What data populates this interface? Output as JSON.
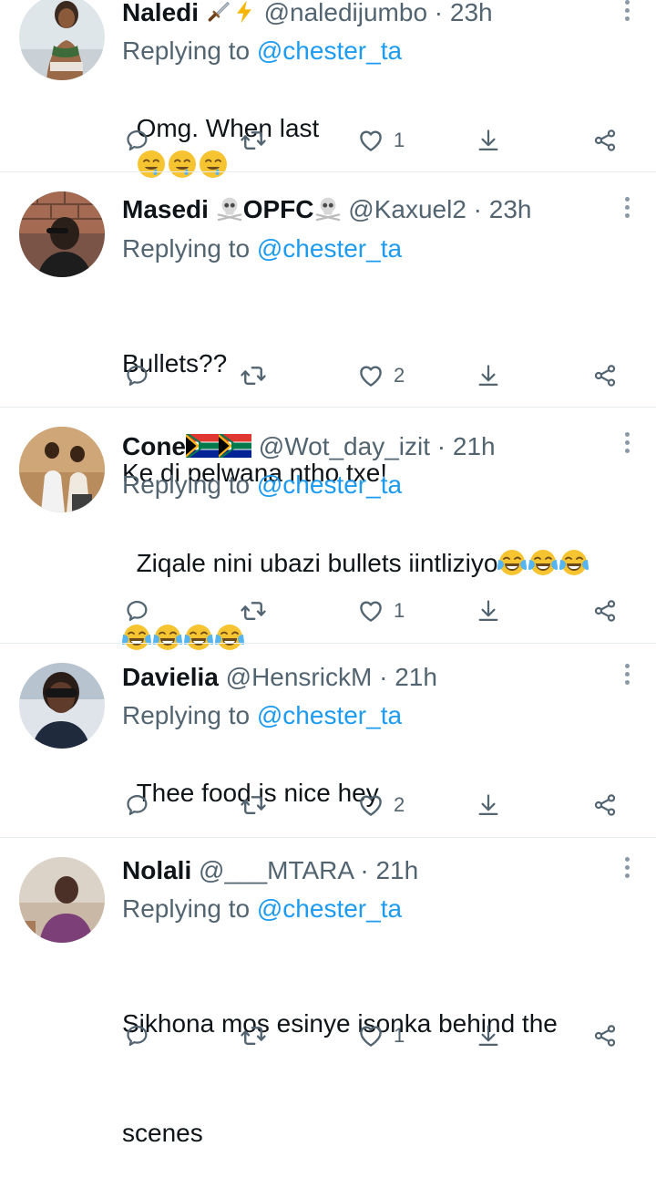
{
  "reply_prefix": "Replying to ",
  "reply_target": "@chester_ta",
  "tweets": [
    {
      "name": "Naledi",
      "handle": "@naledijumbo",
      "dot": "·",
      "time": "23h",
      "text_line1": "Omg. When last",
      "like_count": "1",
      "emoji": "drooling-face"
    },
    {
      "name": "Masedi",
      "name_mid": "OPFC",
      "handle": "@Kaxuel2",
      "dot": "·",
      "time": "23h",
      "text_line1": "Bullets??",
      "text_line2": "Ke di pelwana ntho txe!",
      "like_count": "2"
    },
    {
      "name": "Cone",
      "handle": "@Wot_day_izit",
      "dot": "·",
      "time": "21h",
      "text_line1": "Ziqale nini ubazi bullets iintliziyo",
      "like_count": "1",
      "emoji": "face-with-tears-of-joy"
    },
    {
      "name": "Davielia",
      "handle": "@HensrickM",
      "dot": "·",
      "time": "21h",
      "text_line1": "Thee food is nice hey",
      "like_count": "2"
    },
    {
      "name": "Nolali",
      "handle": "@___MTARA",
      "dot": "·",
      "time": "21h",
      "text_line1": "Sikhona mos esinye isonka behind the",
      "text_line2": "scenes",
      "like_count": "1"
    }
  ],
  "colors": {
    "accent": "#1d9bf0",
    "muted": "#536471",
    "text": "#0f1419",
    "divider": "#e6ecf0"
  },
  "icons": {
    "reply": "comment-icon",
    "retweet": "retweet-icon",
    "like": "heart-icon",
    "download": "download-icon",
    "share": "share-icon",
    "more": "more-vertical-icon"
  }
}
